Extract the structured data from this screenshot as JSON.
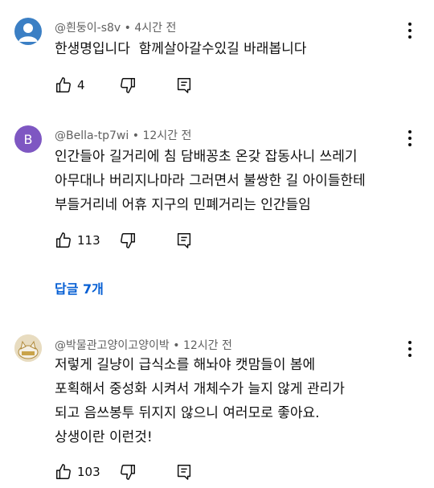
{
  "comments": [
    {
      "author": "@흰둥이-s8v",
      "time": "4시간 전",
      "text": "한생명입니다  함께살아갈수있길 바래봅니다",
      "likes": "4",
      "avatar_letter": "",
      "avatar_color": "#3b7fc4"
    },
    {
      "author": "@Bella-tp7wi",
      "time": "12시간 전",
      "text": "인간들아 길거리에 침 담배꽁초 온갖 잡동사니 쓰레기\n아무대나 버리지나마라 그러면서 불쌍한 길 아이들한테\n부들거리네 어휴 지구의 민폐거리는 인간들임",
      "likes": "113",
      "avatar_letter": "B",
      "avatar_color": "#7e57c2"
    },
    {
      "author": "@박물관고양이고양이박",
      "time": "12시간 전",
      "text": "저렇게 길냥이 급식소를 해놔야 캣맘들이 봄에\n포획해서 중성화 시켜서 개체수가 늘지 않게 관리가\n되고 음쓰봉투 뒤지지 않으니 여러모로 좋아요.\n상생이란 이런것!",
      "likes": "103",
      "avatar_letter": "",
      "avatar_color": "#c9a34a"
    }
  ],
  "replies_label": "답글 7개",
  "separator": "•",
  "icons": {
    "like": "thumbs-up-icon",
    "dislike": "thumbs-down-icon",
    "reply": "reply-icon",
    "more": "more-vert-icon"
  }
}
